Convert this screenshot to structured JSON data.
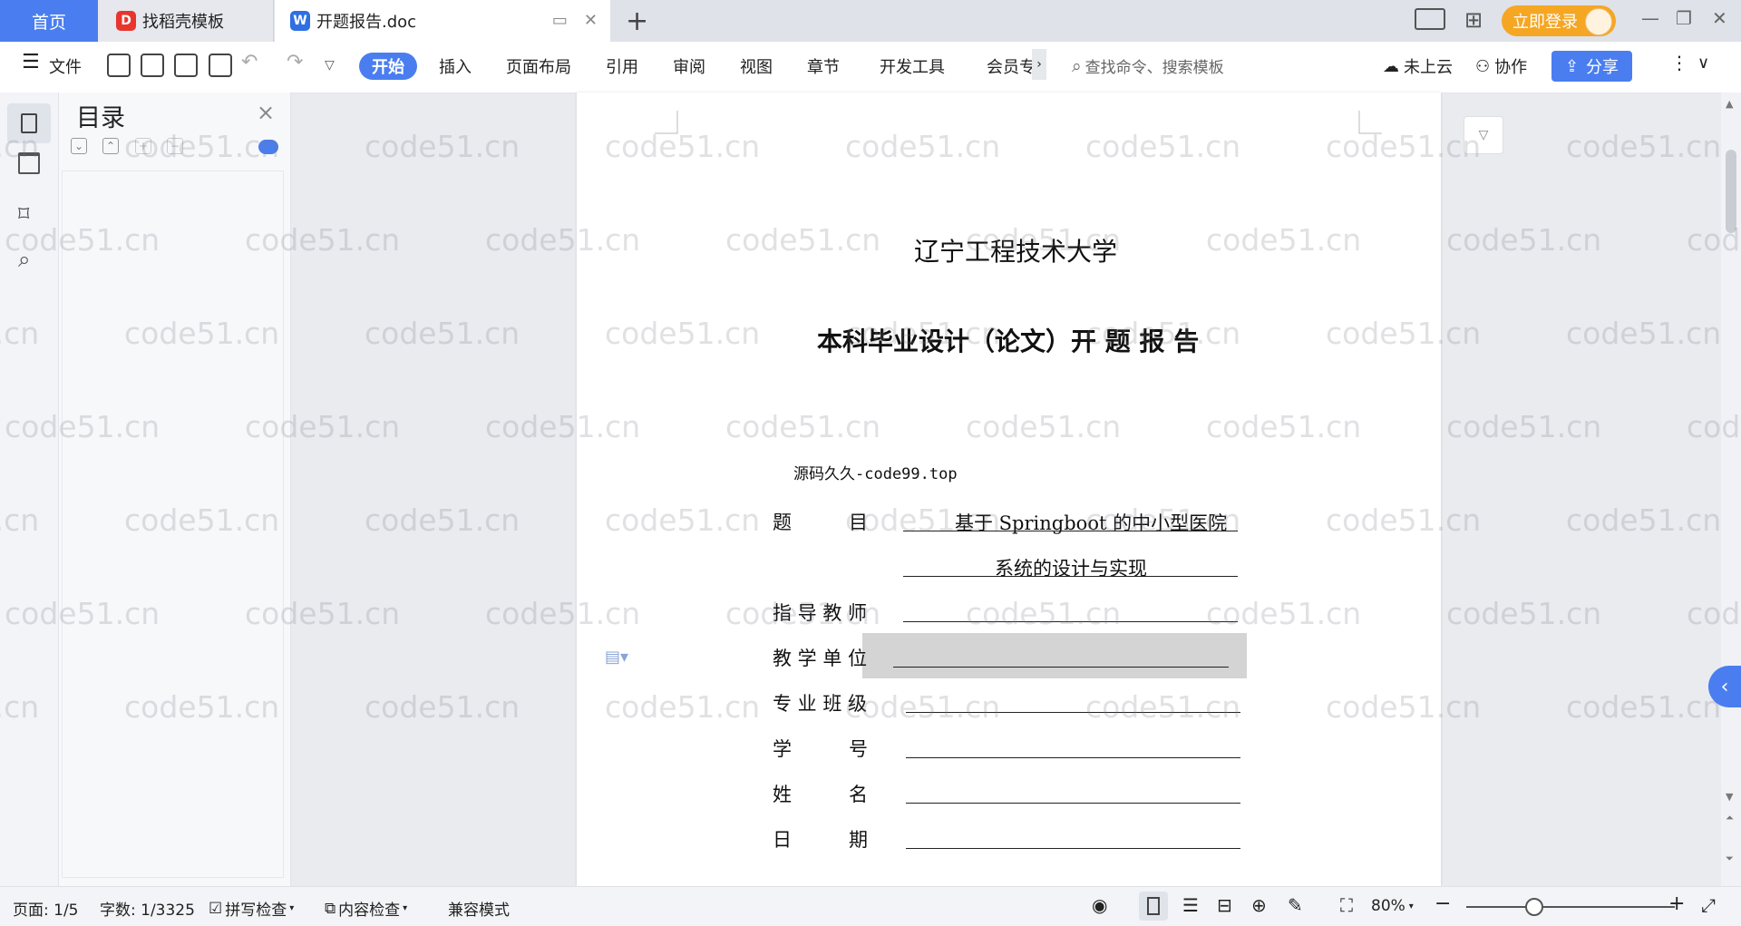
{
  "tabs": {
    "home": "首页",
    "docer": "找稻壳模板",
    "document": "开题报告.doc",
    "login": "立即登录"
  },
  "ribbon": {
    "file": "文件",
    "menus": [
      "开始",
      "插入",
      "页面布局",
      "引用",
      "审阅",
      "视图",
      "章节",
      "开发工具",
      "会员专"
    ],
    "search_placeholder": "查找命令、搜索模板",
    "cloud": "未上云",
    "collab": "协作",
    "share": "分享"
  },
  "outline": {
    "title": "目录"
  },
  "document": {
    "university": "辽宁工程技术大学",
    "report_title": "本科毕业设计（论文）开 题 报 告",
    "source_note": "源码久久-code99.top",
    "fields": [
      {
        "label": "题　　　目",
        "value": "基于 Springboot 的中小型医院"
      },
      {
        "label": "",
        "value": "系统的设计与实现"
      },
      {
        "label": "指 导 教 师",
        "value": ""
      },
      {
        "label": "教 学 单 位",
        "value": ""
      },
      {
        "label": "专 业 班 级",
        "value": ""
      },
      {
        "label": "学　　　号",
        "value": ""
      },
      {
        "label": "姓　　　名",
        "value": ""
      },
      {
        "label": "日　　　期",
        "value": ""
      }
    ]
  },
  "statusbar": {
    "page": "页面: 1/5",
    "wordcount": "字数: 1/3325",
    "spellcheck": "拼写检查",
    "content_check": "内容检查",
    "compat_mode": "兼容模式",
    "zoom": "80%"
  },
  "watermark_text": "code51.cn",
  "colors": {
    "accent": "#4a7ef0",
    "login": "#f5a623"
  }
}
